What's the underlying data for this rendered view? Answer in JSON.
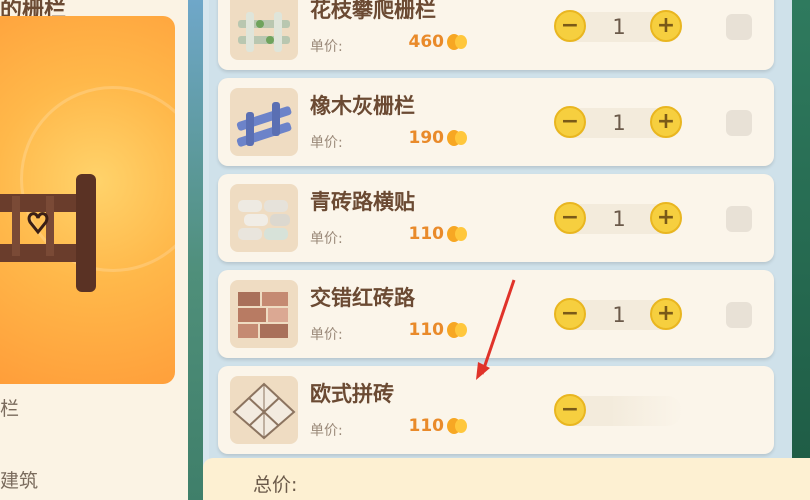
{
  "left_panel": {
    "title": "的栅栏",
    "labels": [
      "栏",
      "建筑"
    ]
  },
  "items": [
    {
      "name": "花枝攀爬栅栏",
      "unit_label": "单价:",
      "price": "460",
      "quantity": "1"
    },
    {
      "name": "橡木灰栅栏",
      "unit_label": "单价:",
      "price": "190",
      "quantity": "1"
    },
    {
      "name": "青砖路横贴",
      "unit_label": "单价:",
      "price": "110",
      "quantity": "1"
    },
    {
      "name": "交错红砖路",
      "unit_label": "单价:",
      "price": "110",
      "quantity": "1"
    },
    {
      "name": "欧式拼砖",
      "unit_label": "单价:",
      "price": "110",
      "quantity": ""
    }
  ],
  "stepper": {
    "minus": "−",
    "plus": "+"
  },
  "footer": {
    "total_label": "总价:"
  },
  "colors": {
    "accent": "#f6cf3f",
    "price": "#e98a2a",
    "arrow": "#e0332a"
  }
}
